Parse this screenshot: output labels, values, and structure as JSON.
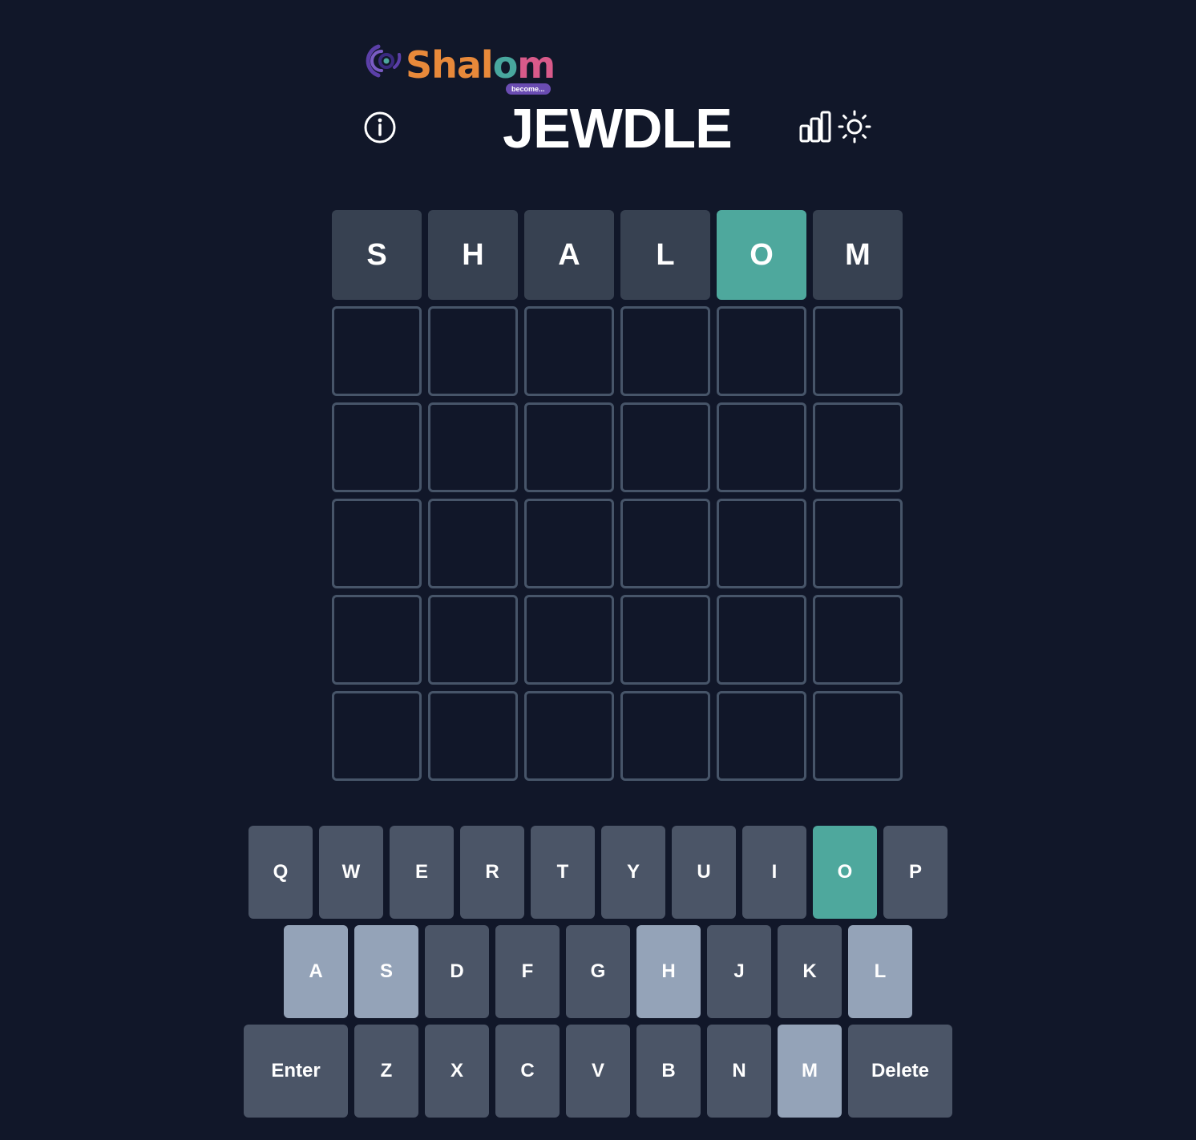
{
  "logo": {
    "parts": [
      "Shal",
      "o",
      "m"
    ],
    "tagline": "become..."
  },
  "header": {
    "title": "JEWDLE",
    "info_icon": "info-circle-icon",
    "stats_icon": "bar-chart-icon",
    "theme_icon": "sun-icon"
  },
  "colors": {
    "background": "#111729",
    "correct": "#4ea89d",
    "absent_tile": "#374151",
    "key_default": "#4b5567",
    "key_used": "#94a3b8",
    "empty_border": "#475569"
  },
  "grid": {
    "rows": [
      [
        {
          "letter": "S",
          "state": "absent"
        },
        {
          "letter": "H",
          "state": "absent"
        },
        {
          "letter": "A",
          "state": "absent"
        },
        {
          "letter": "L",
          "state": "absent"
        },
        {
          "letter": "O",
          "state": "correct"
        },
        {
          "letter": "M",
          "state": "absent"
        }
      ],
      [
        {
          "letter": "",
          "state": "empty"
        },
        {
          "letter": "",
          "state": "empty"
        },
        {
          "letter": "",
          "state": "empty"
        },
        {
          "letter": "",
          "state": "empty"
        },
        {
          "letter": "",
          "state": "empty"
        },
        {
          "letter": "",
          "state": "empty"
        }
      ],
      [
        {
          "letter": "",
          "state": "empty"
        },
        {
          "letter": "",
          "state": "empty"
        },
        {
          "letter": "",
          "state": "empty"
        },
        {
          "letter": "",
          "state": "empty"
        },
        {
          "letter": "",
          "state": "empty"
        },
        {
          "letter": "",
          "state": "empty"
        }
      ],
      [
        {
          "letter": "",
          "state": "empty"
        },
        {
          "letter": "",
          "state": "empty"
        },
        {
          "letter": "",
          "state": "empty"
        },
        {
          "letter": "",
          "state": "empty"
        },
        {
          "letter": "",
          "state": "empty"
        },
        {
          "letter": "",
          "state": "empty"
        }
      ],
      [
        {
          "letter": "",
          "state": "empty"
        },
        {
          "letter": "",
          "state": "empty"
        },
        {
          "letter": "",
          "state": "empty"
        },
        {
          "letter": "",
          "state": "empty"
        },
        {
          "letter": "",
          "state": "empty"
        },
        {
          "letter": "",
          "state": "empty"
        }
      ],
      [
        {
          "letter": "",
          "state": "empty"
        },
        {
          "letter": "",
          "state": "empty"
        },
        {
          "letter": "",
          "state": "empty"
        },
        {
          "letter": "",
          "state": "empty"
        },
        {
          "letter": "",
          "state": "empty"
        },
        {
          "letter": "",
          "state": "empty"
        }
      ]
    ]
  },
  "keyboard": {
    "rows": [
      [
        {
          "label": "Q",
          "state": "default"
        },
        {
          "label": "W",
          "state": "default"
        },
        {
          "label": "E",
          "state": "default"
        },
        {
          "label": "R",
          "state": "default"
        },
        {
          "label": "T",
          "state": "default"
        },
        {
          "label": "Y",
          "state": "default"
        },
        {
          "label": "U",
          "state": "default"
        },
        {
          "label": "I",
          "state": "default"
        },
        {
          "label": "O",
          "state": "correct"
        },
        {
          "label": "P",
          "state": "default"
        }
      ],
      [
        {
          "label": "A",
          "state": "used"
        },
        {
          "label": "S",
          "state": "used"
        },
        {
          "label": "D",
          "state": "default"
        },
        {
          "label": "F",
          "state": "default"
        },
        {
          "label": "G",
          "state": "default"
        },
        {
          "label": "H",
          "state": "used"
        },
        {
          "label": "J",
          "state": "default"
        },
        {
          "label": "K",
          "state": "default"
        },
        {
          "label": "L",
          "state": "used"
        }
      ],
      [
        {
          "label": "Enter",
          "state": "default",
          "wide": true
        },
        {
          "label": "Z",
          "state": "default"
        },
        {
          "label": "X",
          "state": "default"
        },
        {
          "label": "C",
          "state": "default"
        },
        {
          "label": "V",
          "state": "default"
        },
        {
          "label": "B",
          "state": "default"
        },
        {
          "label": "N",
          "state": "default"
        },
        {
          "label": "M",
          "state": "used"
        },
        {
          "label": "Delete",
          "state": "default",
          "wide": true
        }
      ]
    ]
  }
}
